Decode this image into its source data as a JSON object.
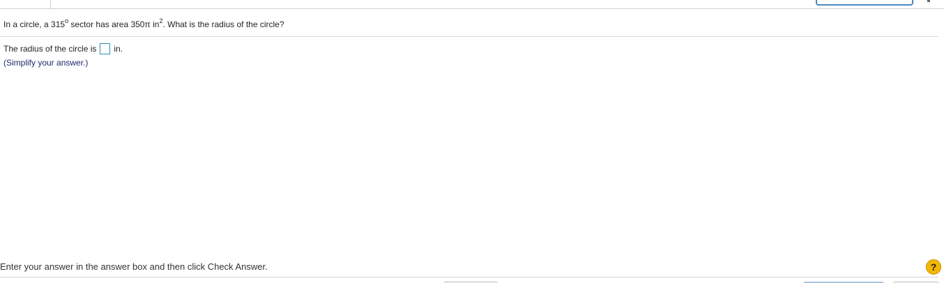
{
  "question": {
    "part1": "In a circle, a 315",
    "degree_symbol": "o",
    "part2": " sector has area 350π in",
    "exponent": "2",
    "part3": ". What is the radius of the circle?"
  },
  "answer": {
    "prefix": "The radius of the circle is",
    "value": "",
    "unit": "in.",
    "hint": "(Simplify your answer.)"
  },
  "footer": {
    "instruction": "Enter your answer in the answer box and then click Check Answer.",
    "help_label": "?"
  },
  "colors": {
    "answer_box_border": "#2b8fb3",
    "hint_text": "#1b2a6b",
    "help_button": "#f2b705"
  }
}
